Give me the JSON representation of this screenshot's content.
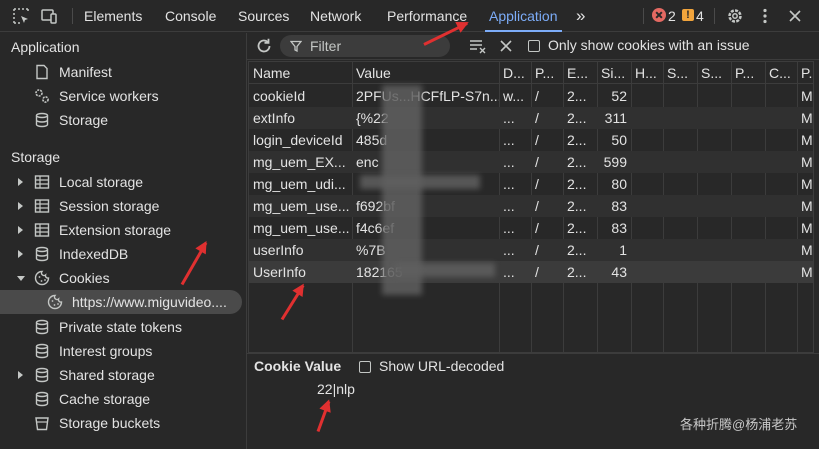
{
  "topbar": {
    "tabs": [
      "Elements",
      "Console",
      "Sources",
      "Network",
      "Performance",
      "Application"
    ],
    "active_tab": "Application",
    "more_glyph": "»",
    "error_count": "2",
    "warning_count": "4",
    "icons": [
      "inspect-element-icon",
      "device-toggle-icon",
      "error-icon",
      "warning-icon",
      "settings-gear-icon",
      "more-vert-icon",
      "close-icon"
    ]
  },
  "sidebar": {
    "application_header": "Application",
    "application_items": [
      {
        "label": "Manifest",
        "icon": "document-icon"
      },
      {
        "label": "Service workers",
        "icon": "gears-icon"
      },
      {
        "label": "Storage",
        "icon": "database-icon"
      }
    ],
    "storage_header": "Storage",
    "storage_items": [
      {
        "label": "Local storage",
        "icon": "table-icon",
        "expandable": true
      },
      {
        "label": "Session storage",
        "icon": "table-icon",
        "expandable": true
      },
      {
        "label": "Extension storage",
        "icon": "table-icon",
        "expandable": true
      },
      {
        "label": "IndexedDB",
        "icon": "database-icon",
        "expandable": true
      },
      {
        "label": "Cookies",
        "icon": "cookie-icon",
        "expanded": true
      },
      {
        "label": "https://www.miguvideo....",
        "icon": "cookie-icon",
        "selected": true
      },
      {
        "label": "Private state tokens",
        "icon": "database-icon"
      },
      {
        "label": "Interest groups",
        "icon": "database-icon"
      },
      {
        "label": "Shared storage",
        "icon": "database-icon",
        "expandable": true
      },
      {
        "label": "Cache storage",
        "icon": "database-icon"
      },
      {
        "label": "Storage buckets",
        "icon": "bucket-icon"
      }
    ]
  },
  "filterbar": {
    "filter_placeholder": "Filter",
    "only_issues_label": "Only show cookies with an issue"
  },
  "cookie_table": {
    "columns": [
      "Name",
      "Value",
      "D...",
      "P...",
      "E...",
      "Si...",
      "H...",
      "S...",
      "S...",
      "P...",
      "C...",
      "P..."
    ],
    "rows": [
      [
        "cookieId",
        "2PFUs...HCFfLP-S7n...",
        "w...",
        "/",
        "2...",
        "52",
        "",
        "",
        "",
        "",
        "",
        "M..."
      ],
      [
        "extInfo",
        "{%22",
        "...",
        "/",
        "2...",
        "311",
        "",
        "",
        "",
        "",
        "",
        "M..."
      ],
      [
        "login_deviceId",
        "485d",
        "...",
        "/",
        "2...",
        "50",
        "",
        "",
        "",
        "",
        "",
        "M..."
      ],
      [
        "mg_uem_EX...",
        "enc",
        "...",
        "/",
        "2...",
        "599",
        "",
        "",
        "",
        "",
        "",
        "M..."
      ],
      [
        "mg_uem_udi...",
        "",
        "...",
        "/",
        "2...",
        "80",
        "",
        "",
        "",
        "",
        "",
        "M..."
      ],
      [
        "mg_uem_use...",
        "f692bf",
        "...",
        "/",
        "2...",
        "83",
        "",
        "",
        "",
        "",
        "",
        "M..."
      ],
      [
        "mg_uem_use...",
        "f4c6ef",
        "...",
        "/",
        "2...",
        "83",
        "",
        "",
        "",
        "",
        "",
        "M..."
      ],
      [
        "userInfo",
        "%7B",
        "...",
        "/",
        "2...",
        "1",
        "",
        "",
        "",
        "",
        "",
        "M..."
      ],
      [
        "UserInfo",
        "182165",
        "...",
        "/",
        "2...",
        "43",
        "",
        "",
        "",
        "",
        "",
        "M..."
      ]
    ],
    "selected_row": 8
  },
  "cookie_value": {
    "title": "Cookie Value",
    "decode_label": "Show URL-decoded",
    "value_visible": "22|nlp"
  },
  "watermark": "各种折腾@杨浦老苏",
  "colors": {
    "accent": "#7cacf8",
    "error": "#e46962",
    "warning": "#f1a43c",
    "annotation_arrow": "#e03030"
  }
}
